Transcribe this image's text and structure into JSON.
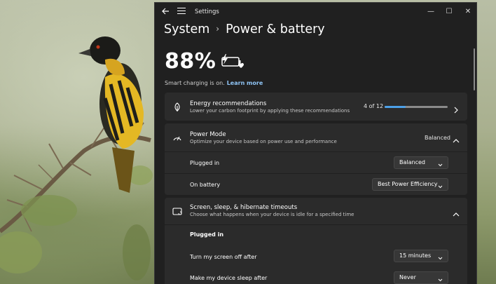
{
  "window": {
    "title": "Settings",
    "controls": {
      "minimize": "—",
      "maximize": "☐",
      "close": "✕"
    }
  },
  "breadcrumb": {
    "parent": "System",
    "separator": "›",
    "current": "Power & battery"
  },
  "battery": {
    "percent": "88%",
    "icon": "battery-charging-heart-icon"
  },
  "smart_charging": {
    "text": "Smart charging is on.",
    "link": "Learn more"
  },
  "energy": {
    "title": "Energy recommendations",
    "desc": "Lower your carbon footprint by applying these recommendations",
    "count": "4 of 12",
    "progress": 0.33
  },
  "power_mode": {
    "title": "Power Mode",
    "desc": "Optimize your device based on power use and performance",
    "value": "Balanced",
    "rows": [
      {
        "label": "Plugged in",
        "value": "Balanced"
      },
      {
        "label": "On battery",
        "value": "Best Power Efficiency"
      }
    ]
  },
  "timeouts": {
    "title": "Screen, sleep, & hibernate timeouts",
    "desc": "Choose what happens when your device is idle for a specified time",
    "section": "Plugged in",
    "rows": [
      {
        "label": "Turn my screen off after",
        "value": "15 minutes"
      },
      {
        "label": "Make my device sleep after",
        "value": "Never"
      }
    ]
  },
  "colors": {
    "accent": "#4ca0e8",
    "link": "#8fc4f5",
    "window_bg": "#202020",
    "card_bg": "#2b2b2b"
  }
}
